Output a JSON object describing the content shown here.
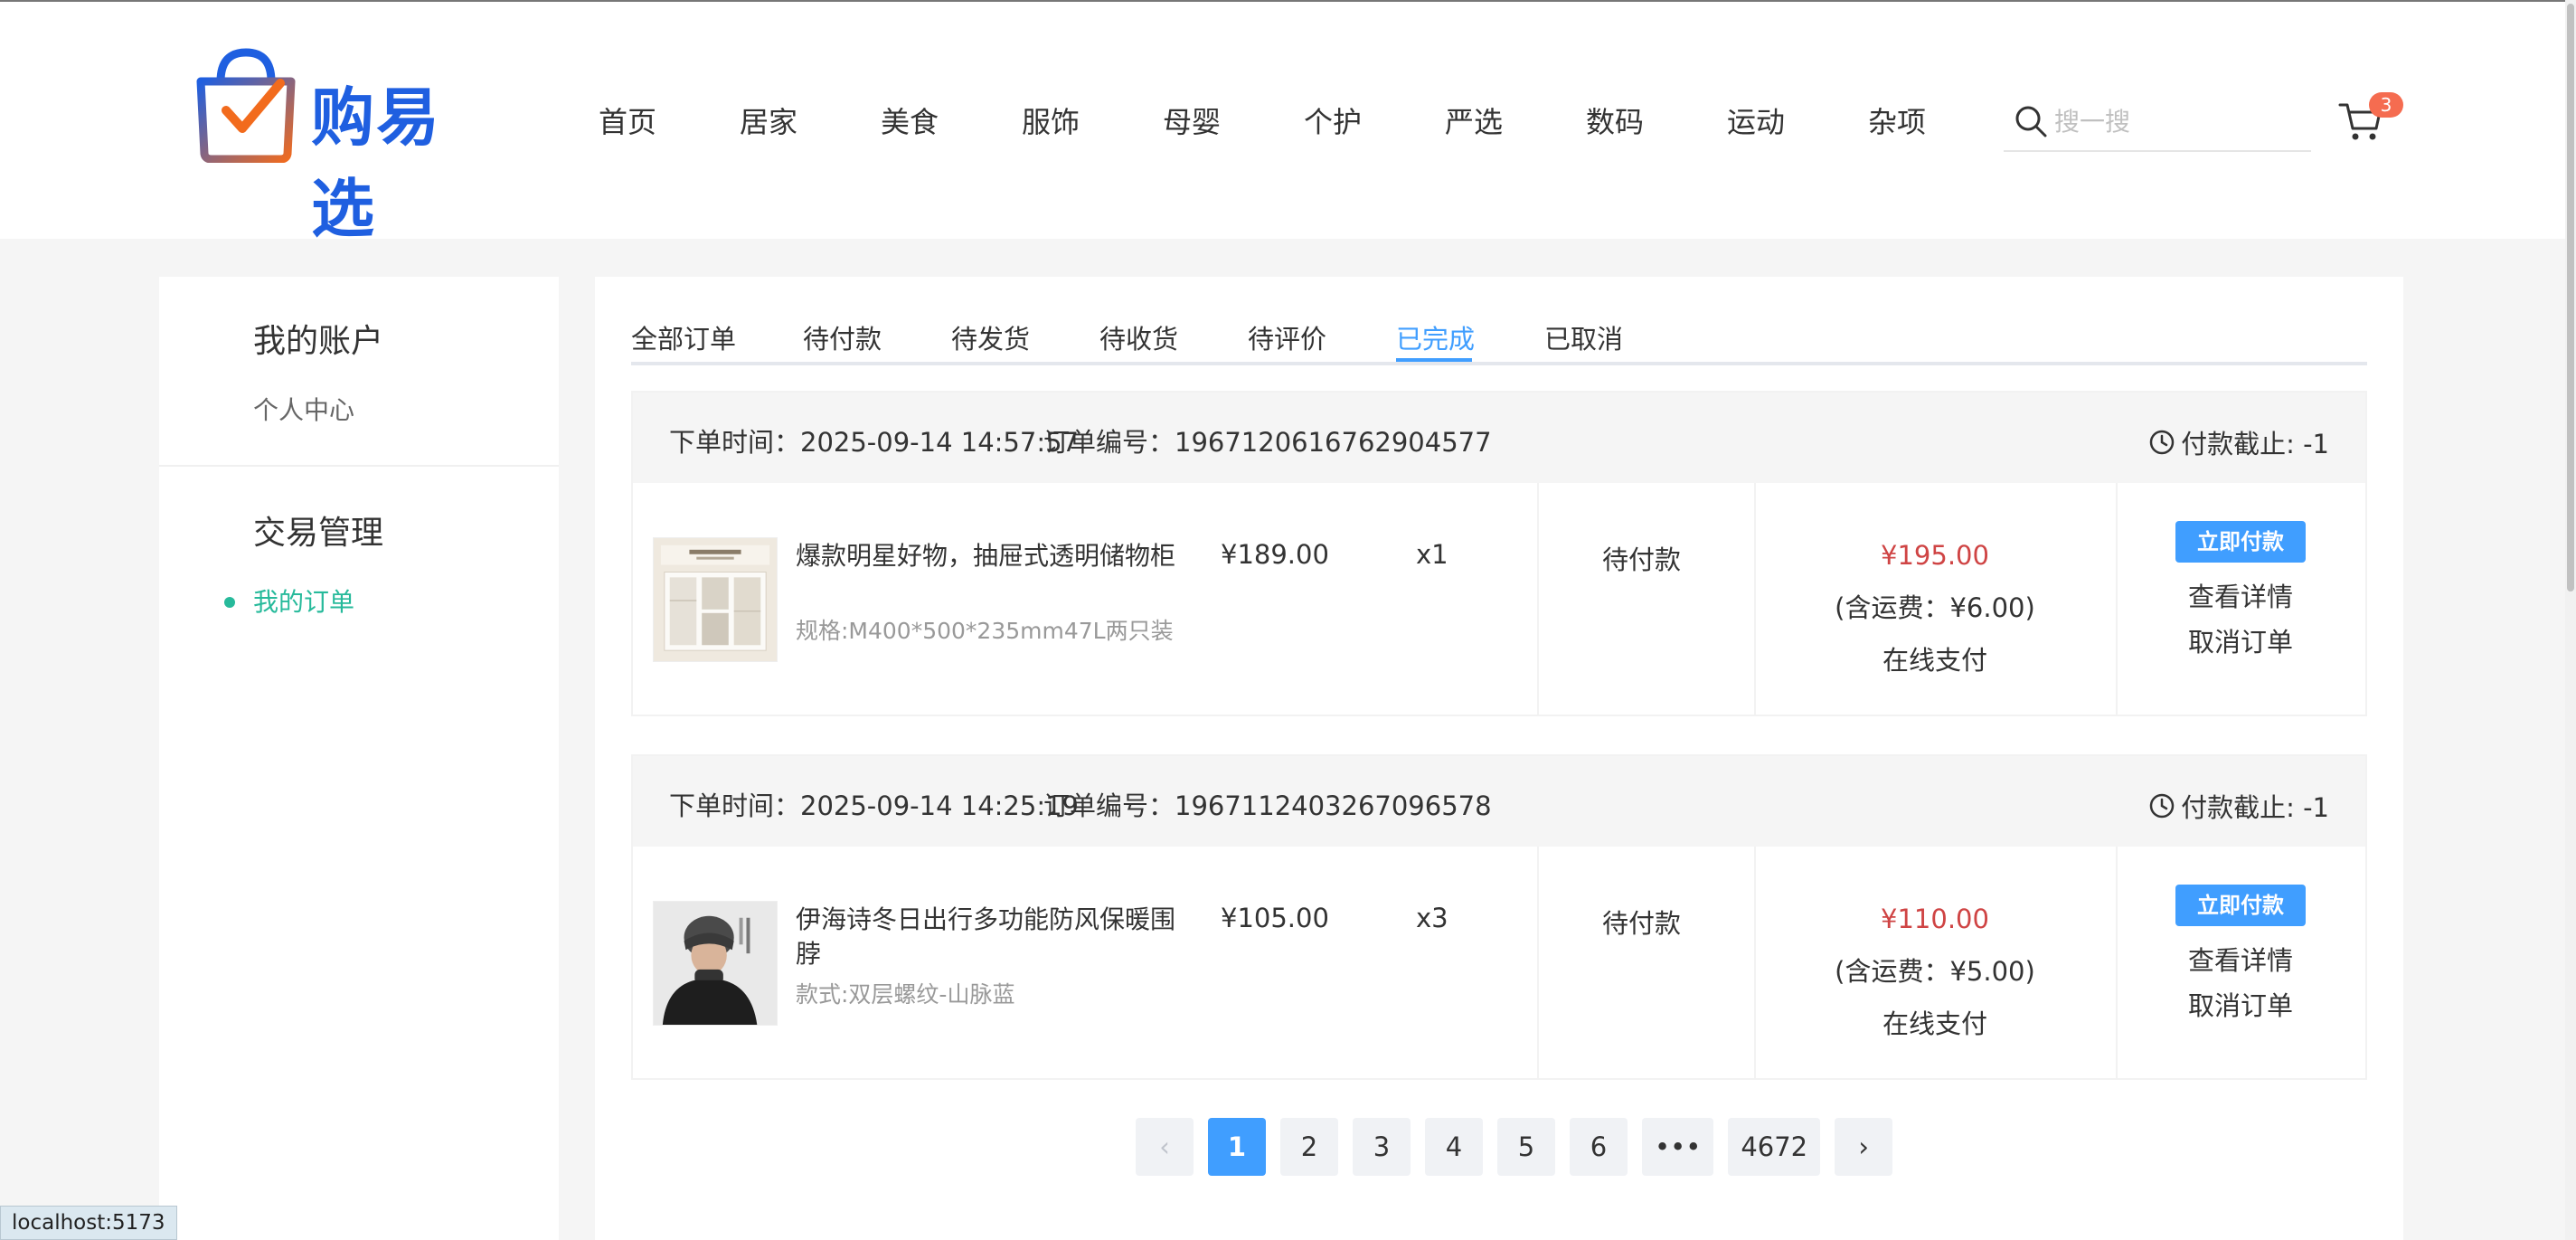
{
  "header": {
    "logo_text": "购易选",
    "nav": [
      "首页",
      "居家",
      "美食",
      "服饰",
      "母婴",
      "个护",
      "严选",
      "数码",
      "运动",
      "杂项"
    ],
    "search_placeholder": "搜一搜",
    "cart_count": "3",
    "brand_colors": {
      "primary": "#1f5fe0",
      "accent": "#f26b1d"
    }
  },
  "sidebar": {
    "groups": [
      {
        "title": "我的账户",
        "items": [
          "个人中心"
        ]
      },
      {
        "title": "交易管理",
        "items": [
          "我的订单"
        ]
      }
    ],
    "active_item": "我的订单",
    "active_color": "#27ba9b"
  },
  "tabs": {
    "items": [
      "全部订单",
      "待付款",
      "待发货",
      "待收货",
      "待评价",
      "已完成",
      "已取消"
    ],
    "active": "已完成"
  },
  "orders": [
    {
      "time_label": "下单时间：2025-09-14 14:57:57",
      "no_label": "订单编号：1967120616762904577",
      "deadline": "付款截止: -1",
      "product_name": "爆款明星好物，抽屉式透明储物柜",
      "product_spec": "规格:M400*500*235mm47L两只装",
      "price": "¥189.00",
      "qty": "x1",
      "state": "待付款",
      "total": "¥195.00",
      "shipping": "(含运费：¥6.00)",
      "pay_method": "在线支付",
      "pay_btn": "立即付款",
      "detail_link": "查看详情",
      "cancel_link": "取消订单"
    },
    {
      "time_label": "下单时间：2025-09-14 14:25:19",
      "no_label": "订单编号：1967112403267096578",
      "deadline": "付款截止: -1",
      "product_name": "伊海诗冬日出行多功能防风保暖围脖",
      "product_spec": "款式:双层螺纹-山脉蓝",
      "price": "¥105.00",
      "qty": "x3",
      "state": "待付款",
      "total": "¥110.00",
      "shipping": "(含运费：¥5.00)",
      "pay_method": "在线支付",
      "pay_btn": "立即付款",
      "detail_link": "查看详情",
      "cancel_link": "取消订单"
    }
  ],
  "pagination": {
    "prev": "‹",
    "pages": [
      "1",
      "2",
      "3",
      "4",
      "5",
      "6"
    ],
    "active": "1",
    "ellipsis": "•••",
    "last": "4672",
    "next": "›"
  },
  "status_url": "localhost:5173"
}
